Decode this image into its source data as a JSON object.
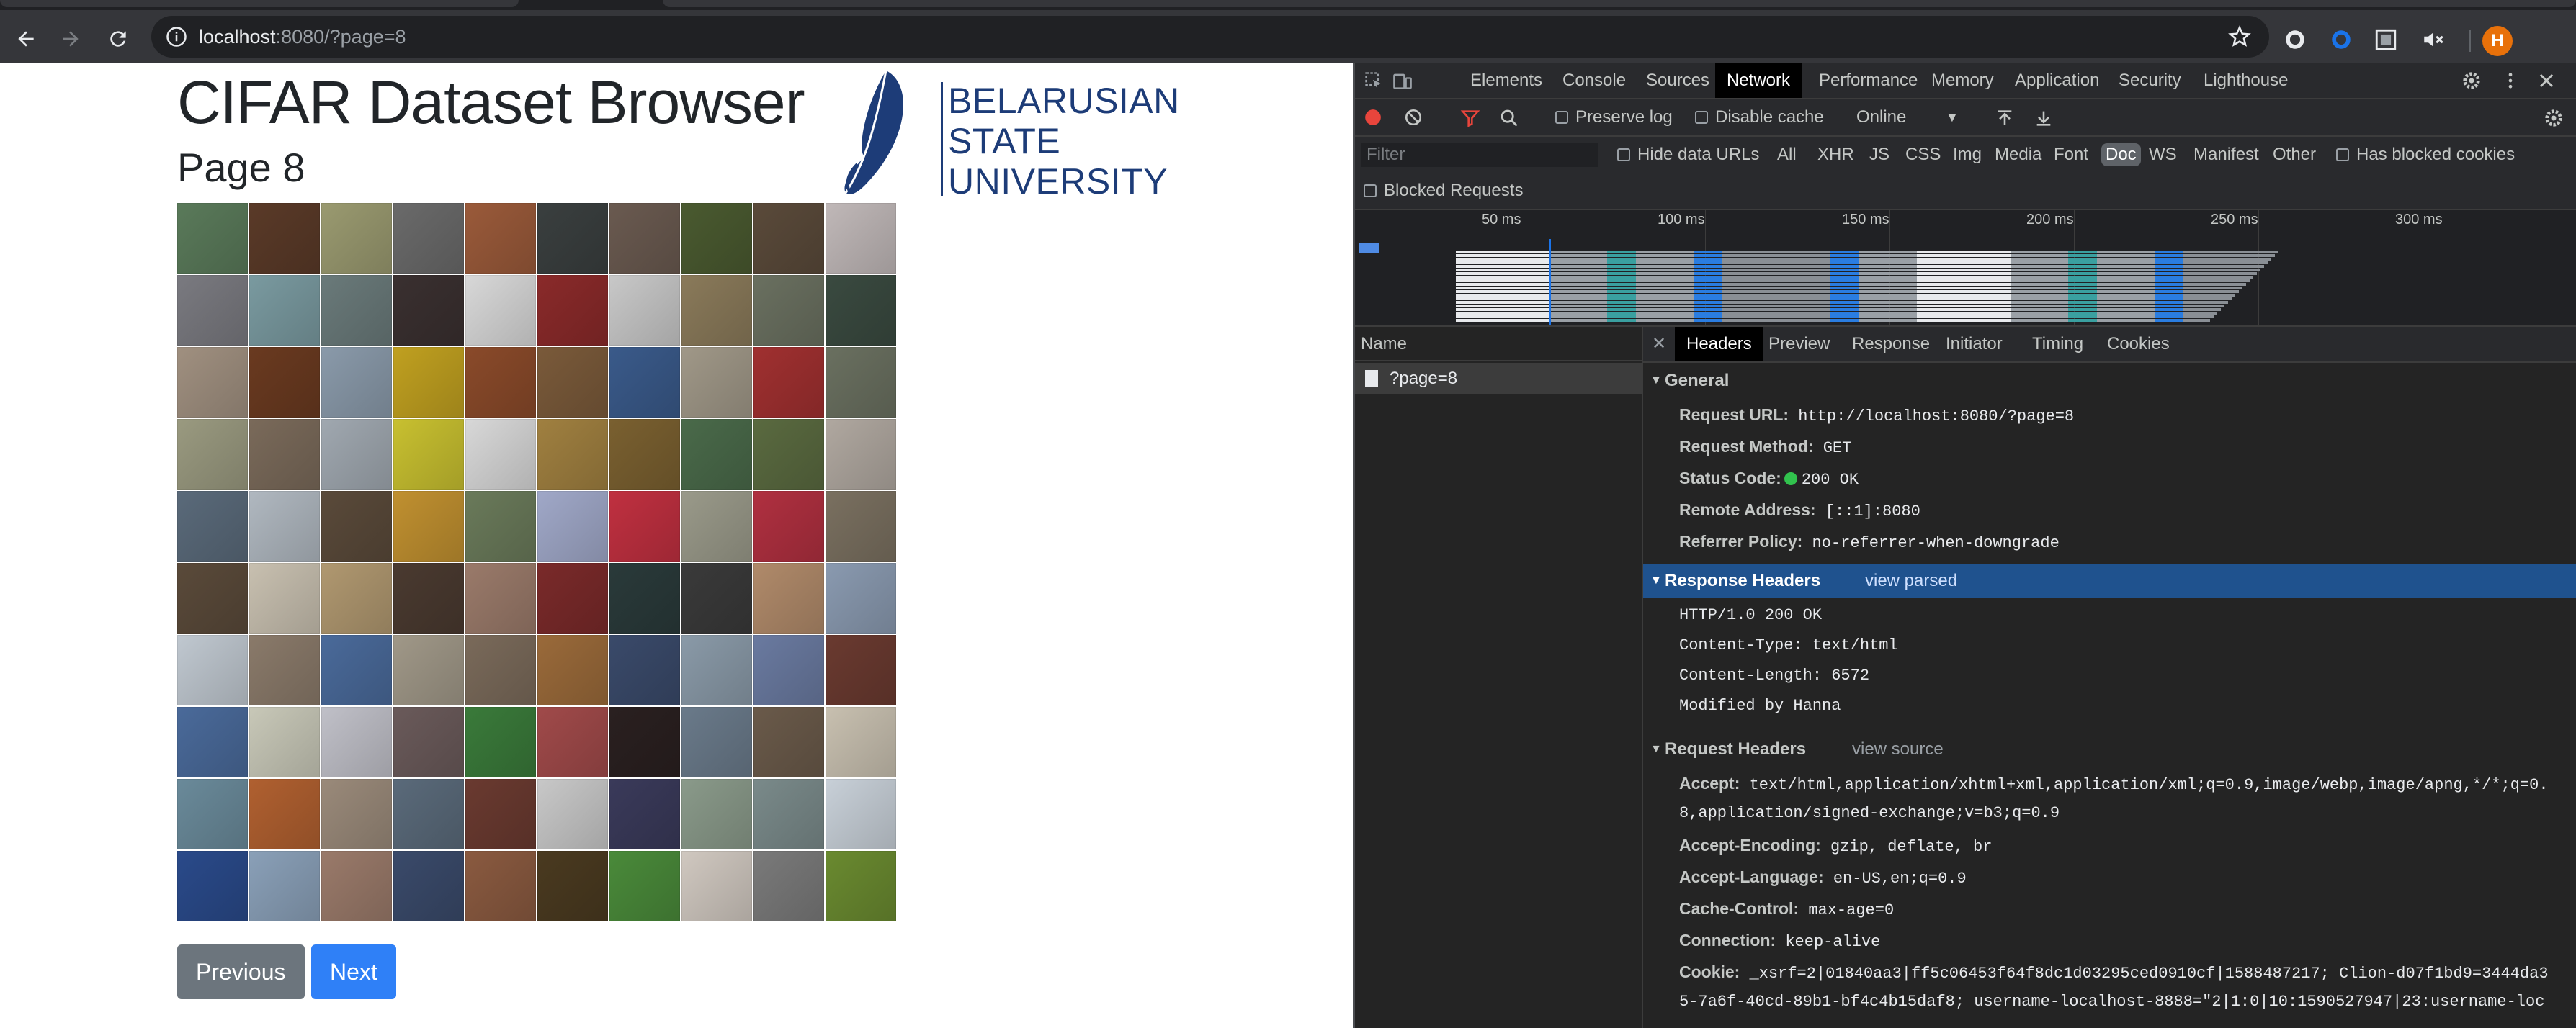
{
  "browser": {
    "url_host": "localhost",
    "url_rest": ":8080/?page=8",
    "avatar_initial": "H",
    "colors": {
      "toolbar": "#35363a",
      "omnibox": "#202124",
      "avatar": "#e8710a"
    }
  },
  "page": {
    "title": "CIFAR Dataset Browser",
    "subtitle": "Page 8",
    "logo_lines": [
      "BELARUSIAN",
      "STATE",
      "UNIVERSITY"
    ],
    "prev_label": "Previous",
    "next_label": "Next",
    "thumb_colors": [
      "#5a7a5a",
      "#5a3a28",
      "#9a9a70",
      "#6a6a6a",
      "#9a5a3a",
      "#3a3f3f",
      "#6a5a50",
      "#4a5a30",
      "#5a4a3a",
      "#c0b8b8",
      "#7a7a80",
      "#7a9aa0",
      "#6a7a7a",
      "#3a3030",
      "#d8d8d8",
      "#8a2a2a",
      "#c8c8c8",
      "#8a7a5a",
      "#6a7060",
      "#3a4a40",
      "#a09080",
      "#6a3a20",
      "#8a9aaa",
      "#c0a020",
      "#8a4a2a",
      "#7a5a3a",
      "#3a5a8a",
      "#a09888",
      "#a03030",
      "#6a7060",
      "#9a9a80",
      "#7a6a5a",
      "#a0a8b0",
      "#c8c030",
      "#d8d8d8",
      "#a08040",
      "#7a6030",
      "#4a6a4a",
      "#5a6a40",
      "#b0a8a0",
      "#5a6a7a",
      "#b0b8c0",
      "#5a4a3a",
      "#c09030",
      "#6a7a5a",
      "#a0a8c8",
      "#c03040",
      "#9a9a8a",
      "#b03040",
      "#7a7060",
      "#5a4a3a",
      "#c8c0b0",
      "#b09870",
      "#4a3a30",
      "#9a7a6a",
      "#7a2a2a",
      "#2a3a3a",
      "#3a3a3a",
      "#b08a6a",
      "#8a9ab0",
      "#c0c8d0",
      "#8a7a6a",
      "#4a6a9a",
      "#a09888",
      "#7a6a5a",
      "#9a6a3a",
      "#3a4a6a",
      "#8a9aa8",
      "#6a7aa0",
      "#6a3a30",
      "#4a6a9a",
      "#c8c8b8",
      "#c0c0c8",
      "#6a5a5a",
      "#3a7a3a",
      "#a04a4a",
      "#2a2020",
      "#6a7a8a",
      "#6a5a4a",
      "#c8c0b0",
      "#6a8a9a",
      "#b06030",
      "#9a8a7a",
      "#5a6a7a",
      "#6a3a30",
      "#c8c8c8",
      "#3a3a5a",
      "#8a9a8a",
      "#7a8a8a",
      "#c8d0d8",
      "#2a4a8a",
      "#8aa0b8",
      "#9a7a6a",
      "#3a4a6a",
      "#8a5a40",
      "#4a3a20",
      "#4a8a3a",
      "#d0c8c0",
      "#7a7a7a",
      "#6a8a30"
    ]
  },
  "devtools": {
    "tabs": [
      "Elements",
      "Console",
      "Sources",
      "Network",
      "Performance",
      "Memory",
      "Application",
      "Security",
      "Lighthouse"
    ],
    "active_tab": "Network",
    "toolbar": {
      "preserve_log": "Preserve log",
      "disable_cache": "Disable cache",
      "throttle": "Online"
    },
    "filter": {
      "placeholder": "Filter",
      "hide_data_urls": "Hide data URLs",
      "types": [
        "All",
        "XHR",
        "JS",
        "CSS",
        "Img",
        "Media",
        "Font",
        "Doc",
        "WS",
        "Manifest",
        "Other"
      ],
      "active_type": "Doc",
      "has_blocked": "Has blocked cookies",
      "blocked_requests": "Blocked Requests"
    },
    "overview_ticks": [
      "50 ms",
      "100 ms",
      "150 ms",
      "200 ms",
      "250 ms",
      "300 ms"
    ],
    "name_header": "Name",
    "request_name": "?page=8",
    "detail_tabs": [
      "Headers",
      "Preview",
      "Response",
      "Initiator",
      "Timing",
      "Cookies"
    ],
    "active_detail_tab": "Headers",
    "general": {
      "title": "General",
      "rows": [
        {
          "k": "Request URL:",
          "v": "http://localhost:8080/?page=8"
        },
        {
          "k": "Request Method:",
          "v": "GET"
        },
        {
          "k": "Status Code:",
          "v": "200 OK"
        },
        {
          "k": "Remote Address:",
          "v": "[::1]:8080"
        },
        {
          "k": "Referrer Policy:",
          "v": "no-referrer-when-downgrade"
        }
      ]
    },
    "response_headers": {
      "title": "Response Headers",
      "link": "view parsed",
      "raw": [
        "HTTP/1.0 200 OK",
        "Content-Type: text/html",
        "Content-Length: 6572",
        "Modified by Hanna"
      ]
    },
    "request_headers": {
      "title": "Request Headers",
      "link": "view source",
      "rows": [
        {
          "k": "Accept:",
          "v": "text/html,application/xhtml+xml,application/xml;q=0.9,image/webp,image/apng,*/*;q=0."
        },
        {
          "k": "",
          "v": "8,application/signed-exchange;v=b3;q=0.9"
        },
        {
          "k": "Accept-Encoding:",
          "v": "gzip, deflate, br"
        },
        {
          "k": "Accept-Language:",
          "v": "en-US,en;q=0.9"
        },
        {
          "k": "Cache-Control:",
          "v": "max-age=0"
        },
        {
          "k": "Connection:",
          "v": "keep-alive"
        },
        {
          "k": "Cookie:",
          "v": "_xsrf=2|01840aa3|ff5c06453f64f8dc1d03295ced0910cf|1588487217; Clion-d07f1bd9=3444da3"
        },
        {
          "k": "",
          "v": "5-7a6f-40cd-89b1-bf4c4b15daf8; username-localhost-8888=\"2|1:0|10:1590527947|23:username-loc"
        }
      ]
    },
    "status_dot_color": "#31c24d"
  }
}
